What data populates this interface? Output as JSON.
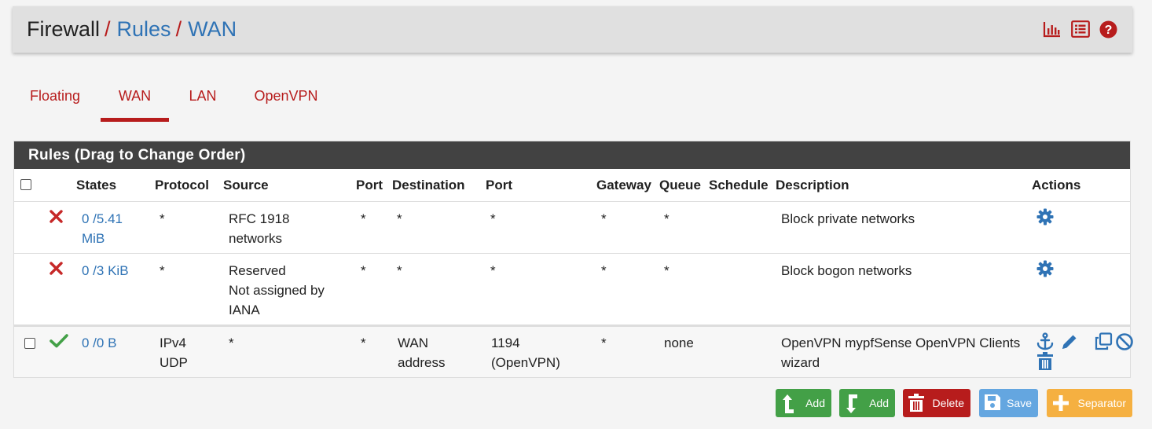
{
  "breadcrumb": [
    "Firewall",
    "Rules",
    "WAN"
  ],
  "header_icons": [
    "chart-icon",
    "list-icon",
    "help-icon"
  ],
  "tabs": [
    "Floating",
    "WAN",
    "LAN",
    "OpenVPN"
  ],
  "active_tab": "WAN",
  "panel_title": "Rules (Drag to Change Order)",
  "columns": [
    "States",
    "Protocol",
    "Source",
    "Port",
    "Destination",
    "Port",
    "Gateway",
    "Queue",
    "Schedule",
    "Description",
    "Actions"
  ],
  "rows": [
    {
      "status": "blocked",
      "states": [
        "0 /5.41",
        "MiB"
      ],
      "protocol": [
        "*"
      ],
      "source": [
        "RFC 1918",
        "networks"
      ],
      "src_port": "*",
      "destination": [
        "*"
      ],
      "dst_port": [
        "*"
      ],
      "gateway": "*",
      "queue": "*",
      "schedule": "",
      "description": [
        "Block private networks"
      ],
      "actions": [
        "gear-icon"
      ]
    },
    {
      "status": "blocked",
      "states": [
        "0 /3 KiB"
      ],
      "protocol": [
        "*"
      ],
      "source": [
        "Reserved",
        "Not assigned by",
        "IANA"
      ],
      "src_port": "*",
      "destination": [
        "*"
      ],
      "dst_port": [
        "*"
      ],
      "gateway": "*",
      "queue": "*",
      "schedule": "",
      "description": [
        "Block bogon networks"
      ],
      "actions": [
        "gear-icon"
      ]
    },
    {
      "status": "pass",
      "states": [
        "0 /0 B"
      ],
      "protocol": [
        "IPv4",
        "UDP"
      ],
      "source": [
        "*"
      ],
      "src_port": "*",
      "destination": [
        "WAN",
        "address"
      ],
      "dst_port": [
        "1194",
        "(OpenVPN)"
      ],
      "gateway": "*",
      "queue": "none",
      "schedule": "",
      "description": [
        "OpenVPN mypfSense OpenVPN Clients",
        "wizard"
      ],
      "actions": [
        "anchor-icon",
        "pencil-icon",
        "copy-icon",
        "disable-icon",
        "trash-icon"
      ]
    }
  ],
  "buttons": {
    "add_top": "Add",
    "add_bottom": "Add",
    "delete": "Delete",
    "save": "Save",
    "separator": "Separator"
  },
  "colors": {
    "accent_red": "#b71c1c",
    "link_blue": "#2f73b5",
    "pass_green": "#43a047",
    "panel_head": "#424242",
    "btn_green": "#43a047",
    "btn_red": "#b71c1c",
    "btn_blue": "#64a6e0",
    "btn_orange": "#f5b041"
  }
}
